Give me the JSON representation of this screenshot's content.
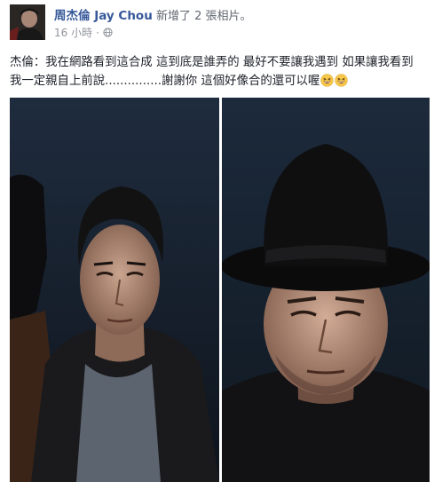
{
  "post": {
    "author": "周杰倫 Jay Chou",
    "action": "新增了 2 張相片。",
    "time": "16 小時",
    "privacy_icon": "globe-icon",
    "message": "杰倫：我在網路看到這合成 這到底是誰弄的 最好不要讓我遇到 如果讓我看到 我一定親自上前說...............謝謝你 這個好像合的還可以喔",
    "emojis": [
      "grinning-squint-emoji",
      "grinning-squint-emoji"
    ]
  },
  "photos": [
    {
      "name": "photo-1",
      "description_icon": "portrait-man-dark-hair"
    },
    {
      "name": "photo-2",
      "description_icon": "portrait-man-black-hat"
    }
  ],
  "colors": {
    "link": "#365899",
    "meta": "#90949c",
    "text": "#1d2129",
    "emoji": "#f7c84a"
  }
}
